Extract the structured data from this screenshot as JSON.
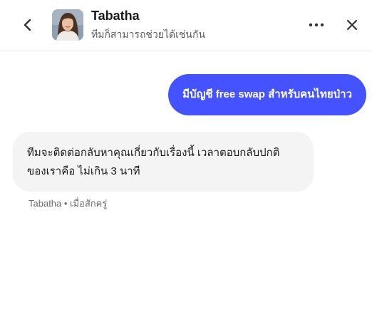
{
  "header": {
    "agent_name": "Tabatha",
    "status_text": "ทีมก็สามารถช่วยได้เช่นกัน"
  },
  "messages": {
    "user_text": "มีบัญชี free swap สำหรับคนไทยป่าว",
    "agent_text": "ทีมจะติดต่อกลับหาคุณเกี่ยวกับเรื่องนี้ เวลาตอบกลับปกติของเราคือ ไม่เกิน 3 นาที",
    "agent_meta": "Tabatha • เมื่อสักครู่"
  },
  "icons": {
    "back": "chevron-left-icon",
    "more": "more-horizontal-icon",
    "close": "close-icon"
  },
  "colors": {
    "user_bubble": "#4552ff",
    "agent_bubble": "#f4f4f4"
  }
}
